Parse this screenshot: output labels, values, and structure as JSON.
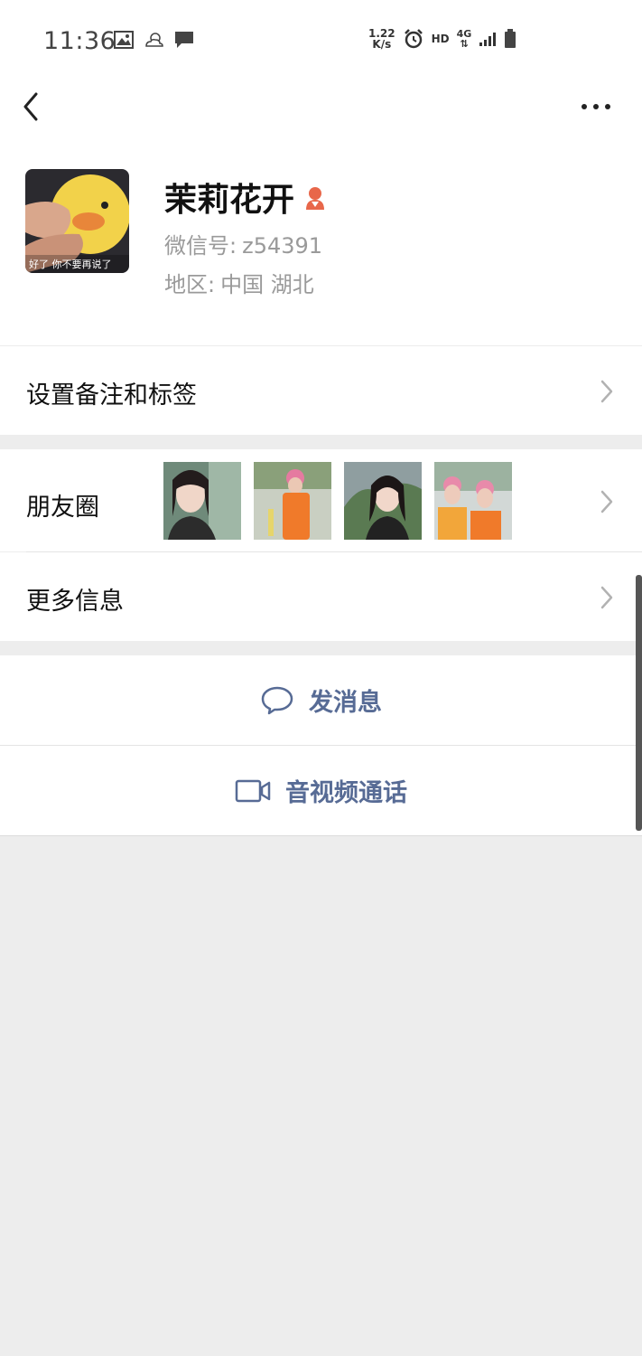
{
  "status_bar": {
    "time": "11:36",
    "net_speed_top": "1.22",
    "net_speed_bottom": "K/s",
    "hd": "HD",
    "network": "4G"
  },
  "profile": {
    "avatar_caption": "好了  你不要再说了",
    "name": "茉莉花开",
    "wechat_id_label": "微信号:",
    "wechat_id": "z54391",
    "region_label": "地区:",
    "region": "中国  湖北"
  },
  "menu": {
    "remark_tags": "设置备注和标签",
    "moments": "朋友圈",
    "more_info": "更多信息"
  },
  "actions": {
    "send_message": "发消息",
    "video_call": "音视频通话"
  },
  "colors": {
    "accent": "#576b95",
    "gender_icon": "#e8674a",
    "background": "#ededed"
  }
}
